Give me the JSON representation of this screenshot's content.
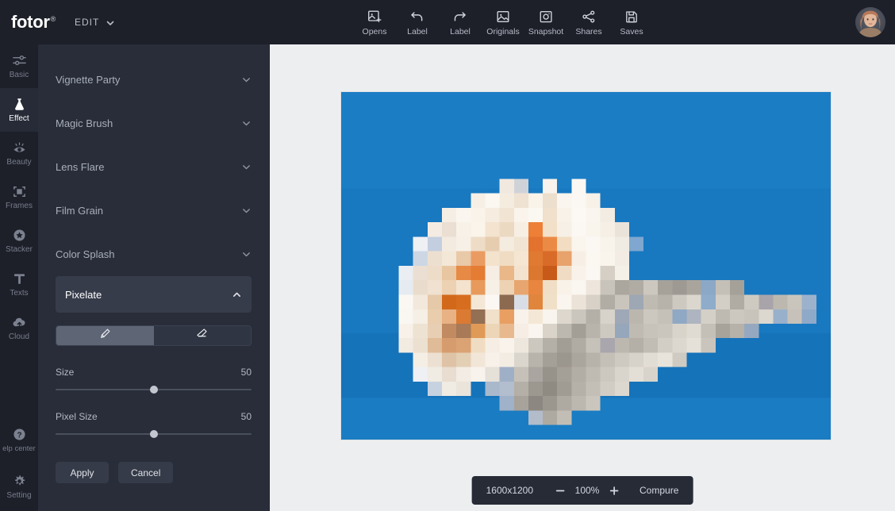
{
  "app": {
    "brand": "fotor",
    "brand_mark": "®",
    "edit_label": "EDIT",
    "accent_blue": "#1878c0",
    "panel_bg": "#282d39",
    "rail_bg": "#1d2029",
    "canvas_bg": "#eceef0"
  },
  "topbar": {
    "tools": [
      {
        "label": "Opens",
        "icon": "image-add-icon"
      },
      {
        "label": "Label",
        "icon": "undo-arrow-icon"
      },
      {
        "label": "Label",
        "icon": "redo-arrow-icon"
      },
      {
        "label": "Originals",
        "icon": "image-icon"
      },
      {
        "label": "Snapshot",
        "icon": "camera-icon"
      },
      {
        "label": "Shares",
        "icon": "share-nodes-icon"
      },
      {
        "label": "Saves",
        "icon": "floppy-save-icon"
      }
    ],
    "avatar": {
      "name": "avatar",
      "icon": "user-photo-icon"
    }
  },
  "sidebar": {
    "items": [
      {
        "label": "Basic",
        "icon": "sliders-icon",
        "active": false
      },
      {
        "label": "Effect",
        "icon": "flask-icon",
        "active": true
      },
      {
        "label": "Beauty",
        "icon": "eye-icon",
        "active": false
      },
      {
        "label": "Frames",
        "icon": "frame-icon",
        "active": false
      },
      {
        "label": "Stacker",
        "icon": "star-badge-icon",
        "active": false
      },
      {
        "label": "Texts",
        "icon": "text-t-icon",
        "active": false
      },
      {
        "label": "Cloud",
        "icon": "cloud-up-icon",
        "active": false
      }
    ],
    "bottom_items": [
      {
        "label": "elp center",
        "icon": "question-circle-icon"
      },
      {
        "label": "Setting",
        "icon": "gear-icon"
      }
    ]
  },
  "effects_panel": {
    "groups": [
      {
        "label": "Vignette Party",
        "open": false,
        "chevron": "chevron-down-icon"
      },
      {
        "label": "Magic Brush",
        "open": false,
        "chevron": "chevron-down-icon"
      },
      {
        "label": "Lens Flare",
        "open": false,
        "chevron": "chevron-down-icon"
      },
      {
        "label": "Film Grain",
        "open": false,
        "chevron": "chevron-down-icon"
      },
      {
        "label": "Color Splash",
        "open": false,
        "chevron": "chevron-down-icon"
      },
      {
        "label": "Pixelate",
        "open": true,
        "chevron": "chevron-up-icon"
      }
    ],
    "mode_toggle": {
      "brush": {
        "icon": "brush-icon",
        "selected": true
      },
      "erase": {
        "icon": "eraser-icon",
        "selected": false
      }
    },
    "sliders": [
      {
        "label": "Size",
        "value": "50",
        "percent": 50
      },
      {
        "label": "Pixel Size",
        "value": "50",
        "percent": 50
      }
    ],
    "actions": {
      "apply": "Apply",
      "cancel": "Cancel"
    }
  },
  "canvas": {
    "cursor": {
      "name": "brush-cursor",
      "icon": "plus-icon"
    },
    "zoombar": {
      "dimensions": "1600x1200",
      "zoom_out_icon": "minus-icon",
      "zoom_level": "100%",
      "zoom_in_icon": "plus-icon",
      "compare_label": "Compure"
    }
  },
  "image_content": {
    "description": "pixelated white rose on blue background",
    "background_color": "#1878c0",
    "pixel_grid": {
      "cols": 34,
      "rows": 24,
      "cell": 18
    },
    "palette": {
      "blue": "#1878c0",
      "blue_dk": "#1570b6",
      "blue_lt": "#2f87c9",
      "cream": "#f6efe6",
      "white": "#fbf8f4",
      "peach": "#f0cdb0",
      "orange": "#e8793a",
      "orange_dk": "#cf5a21",
      "brown": "#8d6a56",
      "tan": "#cdb9a5",
      "grey": "#a3a39c",
      "grey_lt": "#c2bfb6",
      "lav": "#b8c3d5"
    },
    "cells": [
      [
        0,
        18,
        "#1878c0"
      ],
      [
        14,
        6,
        "#f6efe6"
      ],
      [
        16,
        5,
        "#fbf8f4"
      ]
    ]
  }
}
